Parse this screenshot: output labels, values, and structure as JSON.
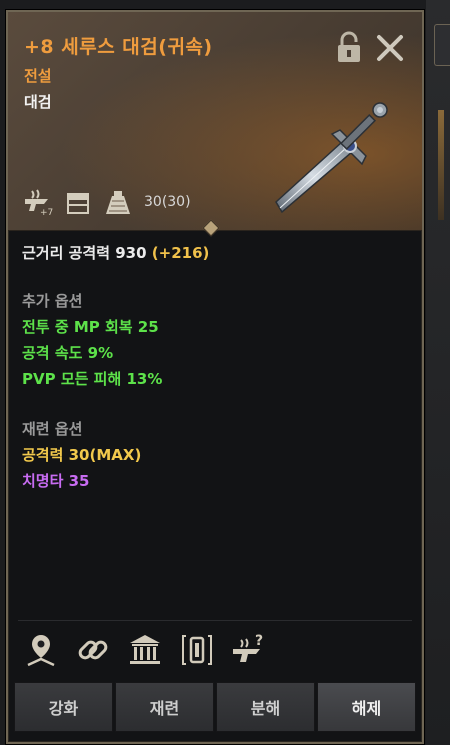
{
  "item": {
    "title": "+8 세루스 대검(귀속)",
    "grade": "전설",
    "type": "대검",
    "weight": "30(30)",
    "enchant_badge": "+7"
  },
  "stats": {
    "main": "근거리 공격력 930",
    "main_bonus": "(+216)"
  },
  "extra_options": {
    "header": "추가 옵션",
    "lines": [
      "전투 중 MP 회복 25",
      "공격 속도 9%",
      "PVP 모든 피해 13%"
    ]
  },
  "refine_options": {
    "header": "재련 옵션",
    "lines": [
      "공격력 30(MAX)",
      "치명타 35"
    ]
  },
  "buttons": [
    "강화",
    "재련",
    "분해",
    "해제"
  ],
  "bottom_icons": [
    "map-pin-icon",
    "link-icon",
    "bank-icon",
    "transfer-icon",
    "anvil-question-icon"
  ],
  "colors": {
    "title": "#ef9c3e",
    "green": "#5de24a",
    "gold": "#f2c94c",
    "purple": "#c86cf2"
  }
}
